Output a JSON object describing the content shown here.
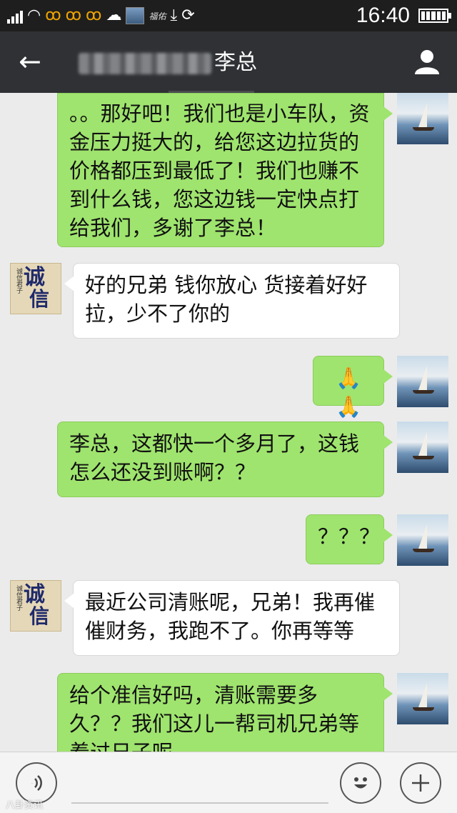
{
  "status_bar": {
    "time": "16:40",
    "carrier_text": "福佑",
    "icons": [
      "signal-icon",
      "wifi-icon",
      "squirrel-icon",
      "squirrel-icon",
      "squirrel-icon",
      "cloud-icon",
      "app-thumbnail-icon",
      "download-icon",
      "sync-icon",
      "battery-icon"
    ]
  },
  "header": {
    "title": "李总",
    "back_icon": "arrow-left-icon",
    "profile_icon": "person-icon"
  },
  "messages": [
    {
      "sender": "me",
      "text": "。。那好吧！我们也是小车队，资金压力挺大的，给您这边拉货的价格都压到最低了！我们也赚不到什么钱，您这边钱一定快点打给我们，多谢了李总！"
    },
    {
      "sender": "other",
      "text": "好的兄弟 钱你放心 货接着好好拉，少不了你的"
    },
    {
      "sender": "me",
      "text": "🙏🙏"
    },
    {
      "sender": "me",
      "text": "李总，这都快一个多月了，这钱怎么还没到账啊？？"
    },
    {
      "sender": "me",
      "text": "？？？"
    },
    {
      "sender": "other",
      "text": "最近公司清账呢，兄弟！我再催催财务，我跑不了。你再等等"
    },
    {
      "sender": "me",
      "text": "给个准信好吗，清账需要多久？？我们这儿一帮司机兄弟等着过日子呢"
    }
  ],
  "avatar_other": {
    "big_chars": "诚",
    "big_chars_2": "信",
    "small_text": "诚信君子"
  },
  "bottom_bar": {
    "voice_icon": "voice-icon",
    "emoji_icon": "smiley-icon",
    "plus_icon": "plus-icon"
  },
  "watermark": "八卦资讯"
}
